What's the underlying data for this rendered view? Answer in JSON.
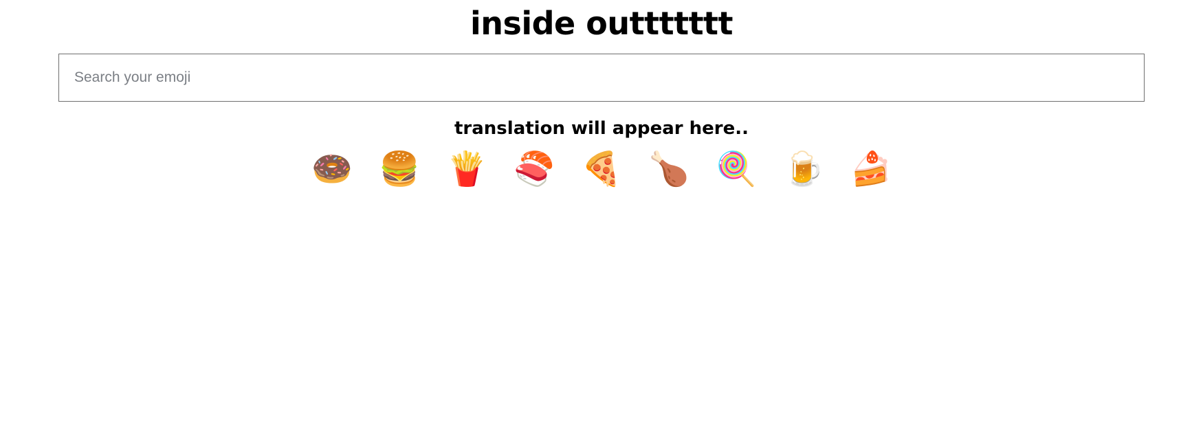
{
  "app": {
    "title": "inside outtttttt"
  },
  "search": {
    "name": "emoji-search",
    "placeholder": "Search your emoji",
    "value": ""
  },
  "translation": {
    "status_text": "translation will appear here.."
  },
  "emoji_list": [
    {
      "icon": "🍩",
      "name": "doughnut"
    },
    {
      "icon": "🍔",
      "name": "hamburger"
    },
    {
      "icon": "🍟",
      "name": "french-fries"
    },
    {
      "icon": "🍣",
      "name": "sushi"
    },
    {
      "icon": "🍕",
      "name": "pizza"
    },
    {
      "icon": "🍗",
      "name": "poultry-leg"
    },
    {
      "icon": "🍭",
      "name": "lollipop"
    },
    {
      "icon": "🍺",
      "name": "beer-mug"
    },
    {
      "icon": "🍰",
      "name": "shortcake"
    }
  ],
  "colors": {
    "background": "#ffffff",
    "text": "#000000",
    "placeholder": "#7b7f85",
    "input_border": "#6e6e6e"
  }
}
